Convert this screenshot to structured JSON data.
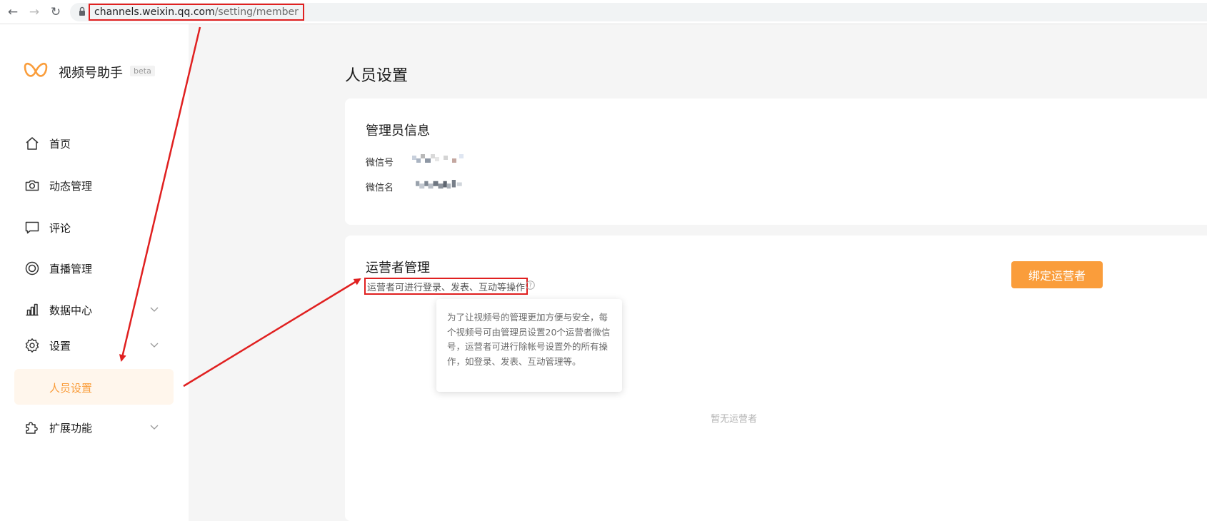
{
  "browser": {
    "url_host": "channels.weixin.qq.com",
    "url_path": "/setting/member"
  },
  "sidebar": {
    "brand": "视频号助手",
    "badge": "beta",
    "items": [
      {
        "label": "首页",
        "icon": "home-icon"
      },
      {
        "label": "动态管理",
        "icon": "camera-icon"
      },
      {
        "label": "评论",
        "icon": "comment-icon"
      },
      {
        "label": "直播管理",
        "icon": "live-icon"
      },
      {
        "label": "数据中心",
        "icon": "chart-icon"
      },
      {
        "label": "设置",
        "icon": "gear-icon"
      },
      {
        "label": "人员设置",
        "icon": ""
      },
      {
        "label": "扩展功能",
        "icon": "puzzle-icon"
      }
    ]
  },
  "main": {
    "page_title": "人员设置",
    "admin_card": {
      "title": "管理员信息",
      "wechat_id_label": "微信号",
      "wechat_name_label": "微信名"
    },
    "ops_card": {
      "title": "运营者管理",
      "description": "运营者可进行登录、发表、互动等操作",
      "tooltip": "为了让视频号的管理更加方便与安全，每个视频号可由管理员设置20个运营者微信号，运营者可进行除帐号设置外的所有操作，如登录、发表、互动管理等。",
      "bind_button": "绑定运营者",
      "empty_text": "暂无运营者"
    }
  },
  "colors": {
    "accent": "#fa9d3b",
    "active_bg": "#fff6ec",
    "annotation": "#e02020"
  }
}
